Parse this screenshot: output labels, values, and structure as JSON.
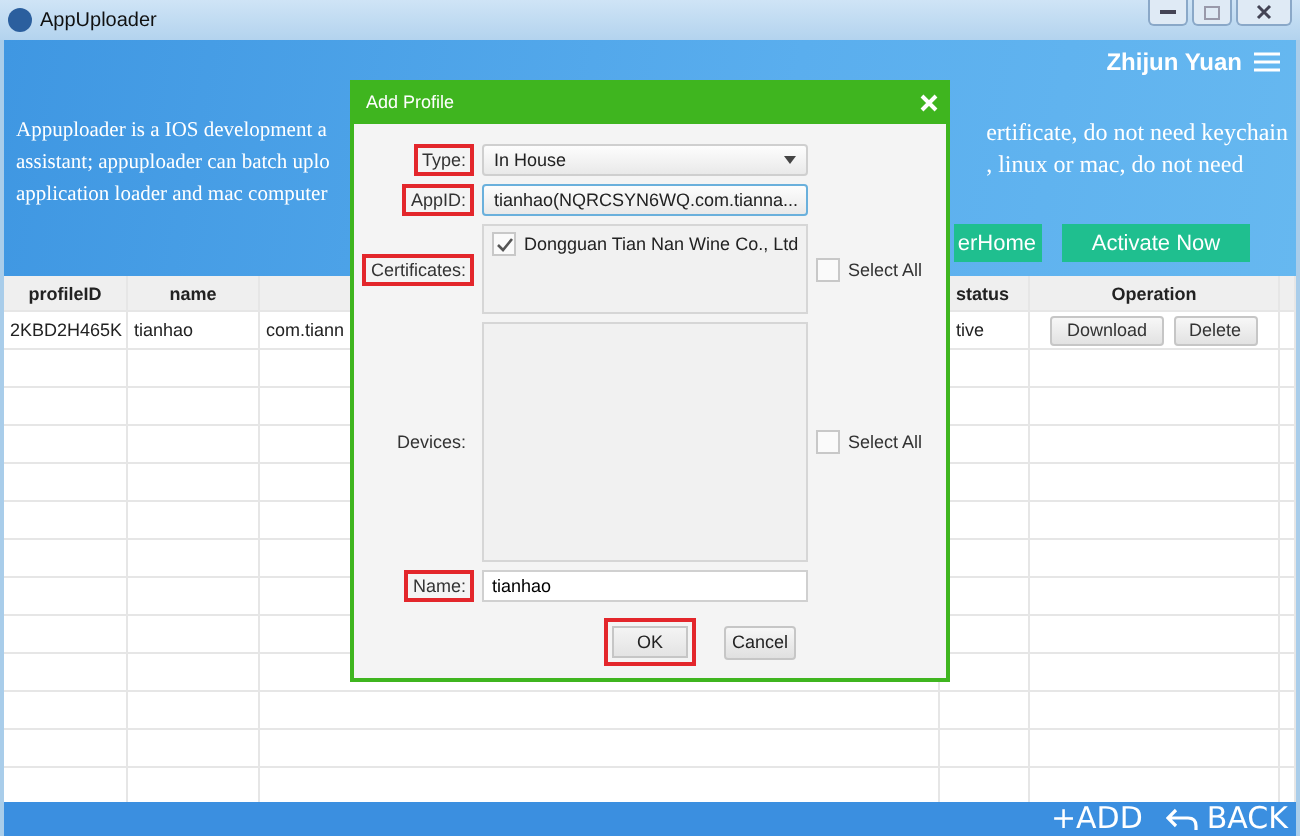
{
  "window": {
    "title": "AppUploader"
  },
  "header": {
    "user": "Zhijun Yuan",
    "description_left": [
      "Appuploader is a IOS development a",
      "assistant; appuploader can batch uplo",
      "application loader and mac computer"
    ],
    "description_right": [
      "ertificate, do not need keychain",
      ", linux or mac, do not need"
    ],
    "buttons": [
      "erHome",
      "Activate Now"
    ]
  },
  "table": {
    "columns": [
      {
        "label": "profileID"
      },
      {
        "label": "name"
      },
      {
        "label": "status"
      },
      {
        "label": "Operation"
      }
    ],
    "rows": [
      {
        "profileID": "2KBD2H465K",
        "name": "tianhao",
        "column_3": "com.tiann",
        "status": "tive",
        "operations": [
          "Download",
          "Delete"
        ]
      }
    ]
  },
  "bottom_bar": {
    "add": "+ADD",
    "back": "BACK"
  },
  "dialog": {
    "title": "Add Profile",
    "type": {
      "label": "Type:",
      "value": "In House",
      "highlighted": true
    },
    "app_id": {
      "label": "AppID:",
      "value": "tianhao(NQRCSYN6WQ.com.tianna...",
      "highlighted": true
    },
    "certificates": {
      "label": "Certificates:",
      "highlighted": true,
      "items": [
        {
          "label": "Dongguan Tian Nan Wine Co., Ltd",
          "checked": true
        }
      ],
      "select_all": {
        "label": "Select All",
        "checked": false
      }
    },
    "devices": {
      "label": "Devices:",
      "highlighted": false,
      "select_all": {
        "label": "Select All",
        "checked": false
      }
    },
    "name": {
      "label": "Name:",
      "value": "tianhao",
      "highlighted": true
    },
    "buttons": [
      {
        "label": "OK",
        "highlighted": true
      },
      {
        "label": "Cancel",
        "highlighted": false
      }
    ]
  }
}
